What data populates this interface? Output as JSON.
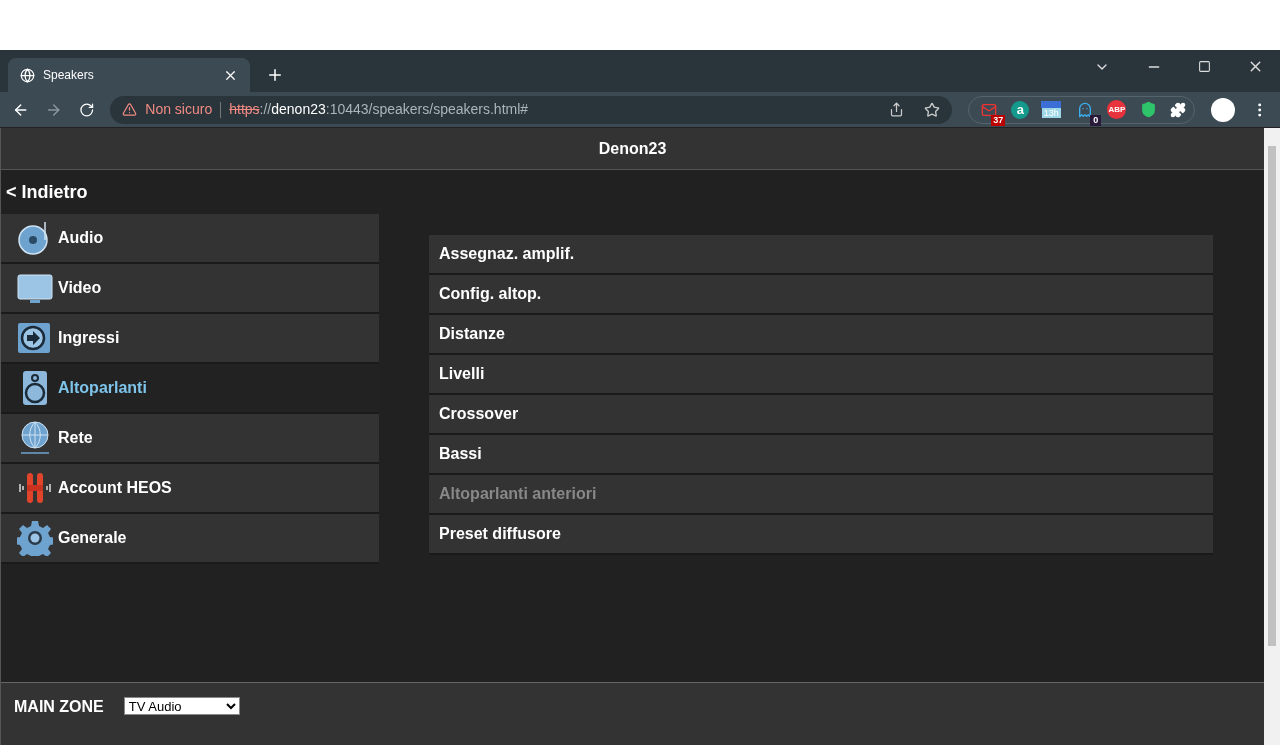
{
  "browser": {
    "tab_title": "Speakers",
    "security": "Non sicuro",
    "url": {
      "scheme": "https",
      "separator": "://",
      "host": "denon23",
      "path": ":10443/speakers/speakers.html#"
    },
    "extensions": [
      {
        "kind": "mail",
        "badge": "37"
      },
      {
        "kind": "letter",
        "badge": "a"
      },
      {
        "kind": "calendar",
        "badge": "13h"
      },
      {
        "kind": "ghost",
        "badge": "0"
      },
      {
        "kind": "adblock",
        "badge": "ABP"
      },
      {
        "kind": "shield"
      }
    ]
  },
  "page": {
    "title": "Denon23",
    "back": "< Indietro",
    "sidebar": [
      {
        "label": "Audio",
        "kind": "disc",
        "selected": false
      },
      {
        "label": "Video",
        "kind": "monitor",
        "selected": false
      },
      {
        "label": "Ingressi",
        "kind": "input",
        "selected": false
      },
      {
        "label": "Altoparlanti",
        "kind": "speaker",
        "selected": true
      },
      {
        "label": "Rete",
        "kind": "globe",
        "selected": false
      },
      {
        "label": "Account HEOS",
        "kind": "heos",
        "selected": false
      },
      {
        "label": "Generale",
        "kind": "gear",
        "selected": false
      }
    ],
    "menu": [
      {
        "label": "Assegnaz. amplif.",
        "disabled": false
      },
      {
        "label": "Config. altop.",
        "disabled": false
      },
      {
        "label": "Distanze",
        "disabled": false
      },
      {
        "label": "Livelli",
        "disabled": false
      },
      {
        "label": "Crossover",
        "disabled": false
      },
      {
        "label": "Bassi",
        "disabled": false
      },
      {
        "label": "Altoparlanti anteriori",
        "disabled": true
      },
      {
        "label": "Preset diffusore",
        "disabled": false
      }
    ],
    "footer": {
      "zone": "MAIN ZONE",
      "source": "TV Audio"
    }
  }
}
